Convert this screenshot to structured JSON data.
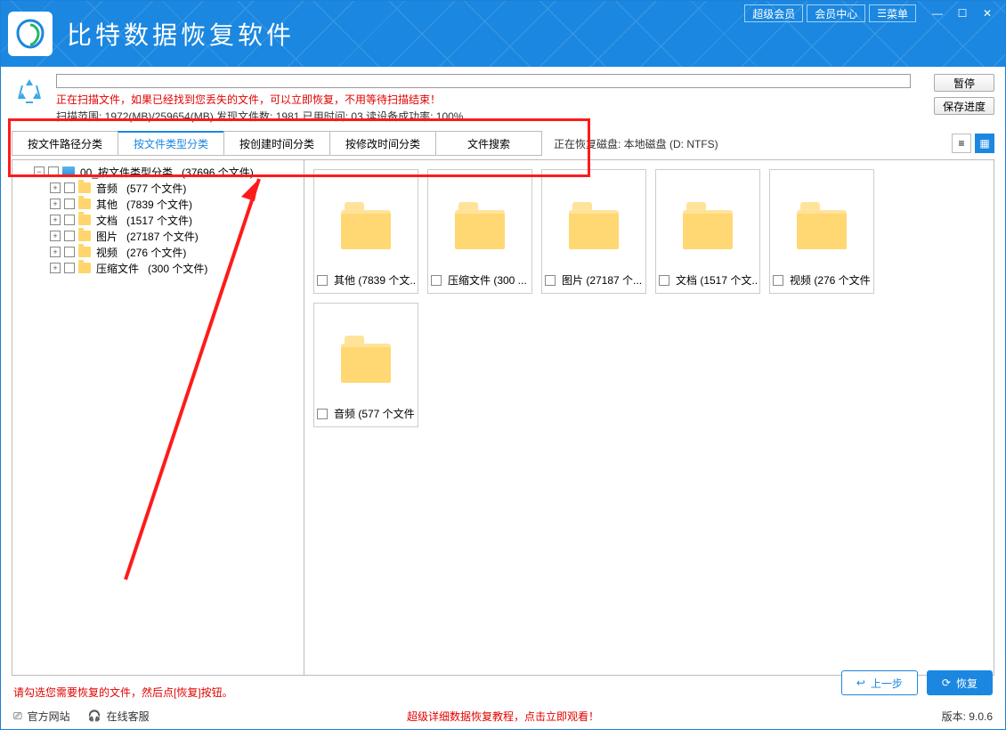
{
  "header": {
    "title": "比特数据恢复软件",
    "vip": "超级会员",
    "member_center": "会员中心",
    "menu": "菜单"
  },
  "scan": {
    "warning": "正在扫描文件，如果已经找到您丢失的文件，可以立即恢复，不用等待扫描结束！",
    "stats": "扫描范围: 1972(MB)/259654(MB)    发现文件数: 1981    已用时间: 03    读设备成功率: 100%",
    "pause": "暂停",
    "save_progress": "保存进度"
  },
  "tabs": [
    {
      "label": "按文件路径分类",
      "active": false
    },
    {
      "label": "按文件类型分类",
      "active": true
    },
    {
      "label": "按创建时间分类",
      "active": false
    },
    {
      "label": "按修改时间分类",
      "active": false
    },
    {
      "label": "文件搜索",
      "active": false
    }
  ],
  "disk_info": "正在恢复磁盘: 本地磁盘 (D: NTFS)",
  "tree": {
    "root": {
      "name": "00_按文件类型分类",
      "count": "(37696 个文件)"
    },
    "children": [
      {
        "name": "音频",
        "count": "(577 个文件)"
      },
      {
        "name": "其他",
        "count": "(7839 个文件)"
      },
      {
        "name": "文档",
        "count": "(1517 个文件)"
      },
      {
        "name": "图片",
        "count": "(27187 个文件)"
      },
      {
        "name": "视频",
        "count": "(276 个文件)"
      },
      {
        "name": "压缩文件",
        "count": "(300 个文件)"
      }
    ]
  },
  "cards": [
    {
      "label": "其他 (7839 个文..."
    },
    {
      "label": "压缩文件 (300 ..."
    },
    {
      "label": "图片 (27187 个..."
    },
    {
      "label": "文档 (1517 个文..."
    },
    {
      "label": "视频 (276 个文件)"
    },
    {
      "label": "音频 (577 个文件)"
    }
  ],
  "hint": "请勾选您需要恢复的文件，然后点[恢复]按钮。",
  "buttons": {
    "prev": "上一步",
    "recover": "恢复"
  },
  "footer": {
    "site": "官方网站",
    "support": "在线客服",
    "tutorial": "超级详细数据恢复教程，点击立即观看！",
    "version": "版本: 9.0.6"
  }
}
